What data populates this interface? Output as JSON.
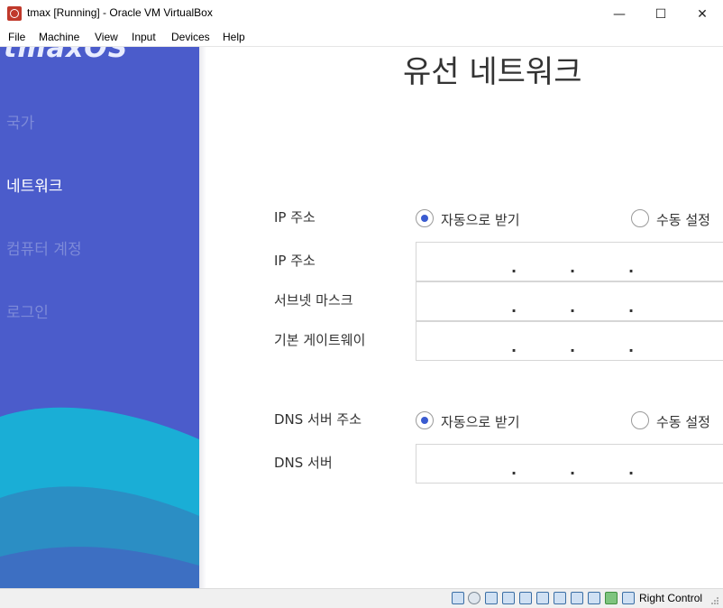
{
  "window": {
    "title": "tmax [Running] - Oracle VM VirtualBox",
    "minimize_glyph": "—",
    "maximize_glyph": "☐",
    "close_glyph": "✕"
  },
  "menu": [
    "File",
    "Machine",
    "View",
    "Input",
    "Devices",
    "Help"
  ],
  "sidebar": {
    "brand": "tmaxOS",
    "items": [
      {
        "label": "국가",
        "active": false
      },
      {
        "label": "네트워크",
        "active": true
      },
      {
        "label": "컴퓨터 계정",
        "active": false
      },
      {
        "label": "로그인",
        "active": false
      }
    ],
    "colors": {
      "background": "#4b5ccb",
      "wave_light": "#1aaed6",
      "wave_dark": "#2b8ec4"
    }
  },
  "main": {
    "title": "유선 네트워크",
    "ip_mode": {
      "label": "IP 주소",
      "auto": "자동으로 받기",
      "manual": "수동 설정",
      "selected": "auto"
    },
    "ip_fields": [
      {
        "label": "IP 주소",
        "value": ". . ."
      },
      {
        "label": "서브넷 마스크",
        "value": ". . ."
      },
      {
        "label": "기본 게이트웨이",
        "value": ". . ."
      }
    ],
    "dns_mode": {
      "label": "DNS 서버 주소",
      "auto": "자동으로 받기",
      "manual": "수동 설정",
      "selected": "auto"
    },
    "dns_field": {
      "label": "DNS 서버",
      "value": ". . ."
    }
  },
  "statusbar": {
    "host_key": "Right Control",
    "icons": [
      "hard-disk-icon",
      "optical-drive-icon",
      "audio-icon",
      "network-icon",
      "usb-icon",
      "shared-folders-icon",
      "display-icon",
      "video-capture-icon",
      "cpu-icon",
      "mouse-integration-icon",
      "keyboard-icon"
    ]
  }
}
